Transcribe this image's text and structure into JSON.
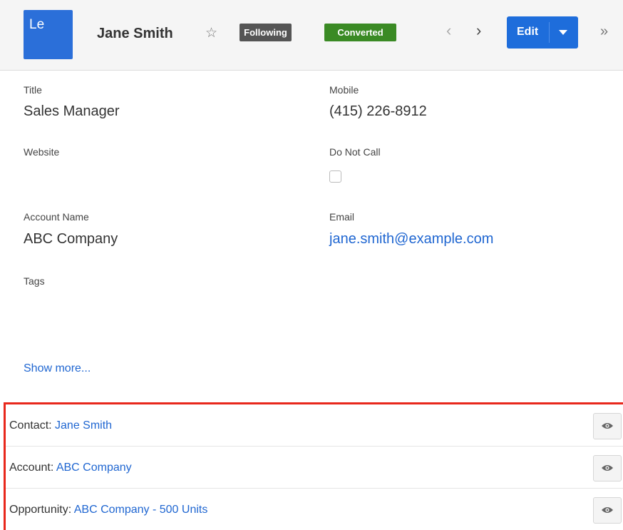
{
  "header": {
    "avatar_label": "Le",
    "name": "Jane Smith",
    "star_icon": "☆",
    "following_label": "Following",
    "converted_label": "Converted",
    "prev_icon": "‹",
    "next_icon": "›",
    "edit_label": "Edit",
    "more_icon": "»"
  },
  "fields": {
    "title_label": "Title",
    "title_value": "Sales Manager",
    "mobile_label": "Mobile",
    "mobile_value": "(415) 226-8912",
    "website_label": "Website",
    "do_not_call_label": "Do Not Call",
    "account_name_label": "Account Name",
    "account_name_value": "ABC Company",
    "email_label": "Email",
    "email_value": "jane.smith@example.com",
    "tags_label": "Tags"
  },
  "show_more": "Show more...",
  "converted_records": [
    {
      "label": "Contact: ",
      "value": "Jane Smith"
    },
    {
      "label": "Account: ",
      "value": "ABC Company"
    },
    {
      "label": "Opportunity: ",
      "value": "ABC Company - 500 Units"
    }
  ],
  "colors": {
    "accent": "#1e6ddb",
    "converted": "#3a8a24",
    "following": "#555555",
    "highlight_border": "#e8281c"
  }
}
